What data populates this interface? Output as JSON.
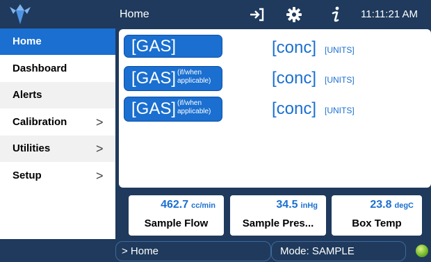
{
  "header": {
    "title": "Home",
    "clock": "11:11:21 AM",
    "icons": [
      "logout-icon",
      "gear-icon",
      "info-icon"
    ]
  },
  "sidebar": {
    "items": [
      {
        "label": "Home",
        "chevron": ""
      },
      {
        "label": "Dashboard",
        "chevron": ""
      },
      {
        "label": "Alerts",
        "chevron": ""
      },
      {
        "label": "Calibration",
        "chevron": ">"
      },
      {
        "label": "Utilities",
        "chevron": ">"
      },
      {
        "label": "Setup",
        "chevron": ">"
      }
    ]
  },
  "concentrations": [
    {
      "gas": "[GAS]",
      "note_line1": "",
      "note_line2": "",
      "conc": "[conc]",
      "units": "[UNITS]"
    },
    {
      "gas": "[GAS]",
      "note_line1": "(if/when",
      "note_line2": "applicable)",
      "conc": "[conc]",
      "units": "[UNITS]"
    },
    {
      "gas": "[GAS]",
      "note_line1": "(if/when",
      "note_line2": "applicable)",
      "conc": "[conc]",
      "units": "[UNITS]"
    }
  ],
  "tiles": [
    {
      "value": "462.7",
      "unit": "cc/min",
      "name": "Sample Flow"
    },
    {
      "value": "34.5",
      "unit": "inHg",
      "name": "Sample Pres..."
    },
    {
      "value": "23.8",
      "unit": "degC",
      "name": "Box Temp"
    }
  ],
  "footer": {
    "breadcrumb": "> Home",
    "mode": "Mode: SAMPLE"
  },
  "colors": {
    "accent": "#1a6fd0",
    "bar": "#1f3a5c",
    "status": "#6fb52a"
  }
}
